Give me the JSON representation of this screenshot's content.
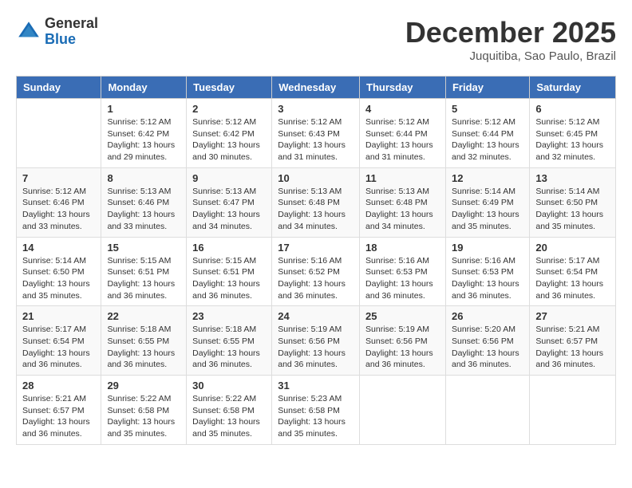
{
  "header": {
    "logo_general": "General",
    "logo_blue": "Blue",
    "month_title": "December 2025",
    "location": "Juquitiba, Sao Paulo, Brazil"
  },
  "weekdays": [
    "Sunday",
    "Monday",
    "Tuesday",
    "Wednesday",
    "Thursday",
    "Friday",
    "Saturday"
  ],
  "weeks": [
    [
      {
        "day": "",
        "info": ""
      },
      {
        "day": "1",
        "info": "Sunrise: 5:12 AM\nSunset: 6:42 PM\nDaylight: 13 hours\nand 29 minutes."
      },
      {
        "day": "2",
        "info": "Sunrise: 5:12 AM\nSunset: 6:42 PM\nDaylight: 13 hours\nand 30 minutes."
      },
      {
        "day": "3",
        "info": "Sunrise: 5:12 AM\nSunset: 6:43 PM\nDaylight: 13 hours\nand 31 minutes."
      },
      {
        "day": "4",
        "info": "Sunrise: 5:12 AM\nSunset: 6:44 PM\nDaylight: 13 hours\nand 31 minutes."
      },
      {
        "day": "5",
        "info": "Sunrise: 5:12 AM\nSunset: 6:44 PM\nDaylight: 13 hours\nand 32 minutes."
      },
      {
        "day": "6",
        "info": "Sunrise: 5:12 AM\nSunset: 6:45 PM\nDaylight: 13 hours\nand 32 minutes."
      }
    ],
    [
      {
        "day": "7",
        "info": "Sunrise: 5:12 AM\nSunset: 6:46 PM\nDaylight: 13 hours\nand 33 minutes."
      },
      {
        "day": "8",
        "info": "Sunrise: 5:13 AM\nSunset: 6:46 PM\nDaylight: 13 hours\nand 33 minutes."
      },
      {
        "day": "9",
        "info": "Sunrise: 5:13 AM\nSunset: 6:47 PM\nDaylight: 13 hours\nand 34 minutes."
      },
      {
        "day": "10",
        "info": "Sunrise: 5:13 AM\nSunset: 6:48 PM\nDaylight: 13 hours\nand 34 minutes."
      },
      {
        "day": "11",
        "info": "Sunrise: 5:13 AM\nSunset: 6:48 PM\nDaylight: 13 hours\nand 34 minutes."
      },
      {
        "day": "12",
        "info": "Sunrise: 5:14 AM\nSunset: 6:49 PM\nDaylight: 13 hours\nand 35 minutes."
      },
      {
        "day": "13",
        "info": "Sunrise: 5:14 AM\nSunset: 6:50 PM\nDaylight: 13 hours\nand 35 minutes."
      }
    ],
    [
      {
        "day": "14",
        "info": "Sunrise: 5:14 AM\nSunset: 6:50 PM\nDaylight: 13 hours\nand 35 minutes."
      },
      {
        "day": "15",
        "info": "Sunrise: 5:15 AM\nSunset: 6:51 PM\nDaylight: 13 hours\nand 36 minutes."
      },
      {
        "day": "16",
        "info": "Sunrise: 5:15 AM\nSunset: 6:51 PM\nDaylight: 13 hours\nand 36 minutes."
      },
      {
        "day": "17",
        "info": "Sunrise: 5:16 AM\nSunset: 6:52 PM\nDaylight: 13 hours\nand 36 minutes."
      },
      {
        "day": "18",
        "info": "Sunrise: 5:16 AM\nSunset: 6:53 PM\nDaylight: 13 hours\nand 36 minutes."
      },
      {
        "day": "19",
        "info": "Sunrise: 5:16 AM\nSunset: 6:53 PM\nDaylight: 13 hours\nand 36 minutes."
      },
      {
        "day": "20",
        "info": "Sunrise: 5:17 AM\nSunset: 6:54 PM\nDaylight: 13 hours\nand 36 minutes."
      }
    ],
    [
      {
        "day": "21",
        "info": "Sunrise: 5:17 AM\nSunset: 6:54 PM\nDaylight: 13 hours\nand 36 minutes."
      },
      {
        "day": "22",
        "info": "Sunrise: 5:18 AM\nSunset: 6:55 PM\nDaylight: 13 hours\nand 36 minutes."
      },
      {
        "day": "23",
        "info": "Sunrise: 5:18 AM\nSunset: 6:55 PM\nDaylight: 13 hours\nand 36 minutes."
      },
      {
        "day": "24",
        "info": "Sunrise: 5:19 AM\nSunset: 6:56 PM\nDaylight: 13 hours\nand 36 minutes."
      },
      {
        "day": "25",
        "info": "Sunrise: 5:19 AM\nSunset: 6:56 PM\nDaylight: 13 hours\nand 36 minutes."
      },
      {
        "day": "26",
        "info": "Sunrise: 5:20 AM\nSunset: 6:56 PM\nDaylight: 13 hours\nand 36 minutes."
      },
      {
        "day": "27",
        "info": "Sunrise: 5:21 AM\nSunset: 6:57 PM\nDaylight: 13 hours\nand 36 minutes."
      }
    ],
    [
      {
        "day": "28",
        "info": "Sunrise: 5:21 AM\nSunset: 6:57 PM\nDaylight: 13 hours\nand 36 minutes."
      },
      {
        "day": "29",
        "info": "Sunrise: 5:22 AM\nSunset: 6:58 PM\nDaylight: 13 hours\nand 35 minutes."
      },
      {
        "day": "30",
        "info": "Sunrise: 5:22 AM\nSunset: 6:58 PM\nDaylight: 13 hours\nand 35 minutes."
      },
      {
        "day": "31",
        "info": "Sunrise: 5:23 AM\nSunset: 6:58 PM\nDaylight: 13 hours\nand 35 minutes."
      },
      {
        "day": "",
        "info": ""
      },
      {
        "day": "",
        "info": ""
      },
      {
        "day": "",
        "info": ""
      }
    ]
  ]
}
